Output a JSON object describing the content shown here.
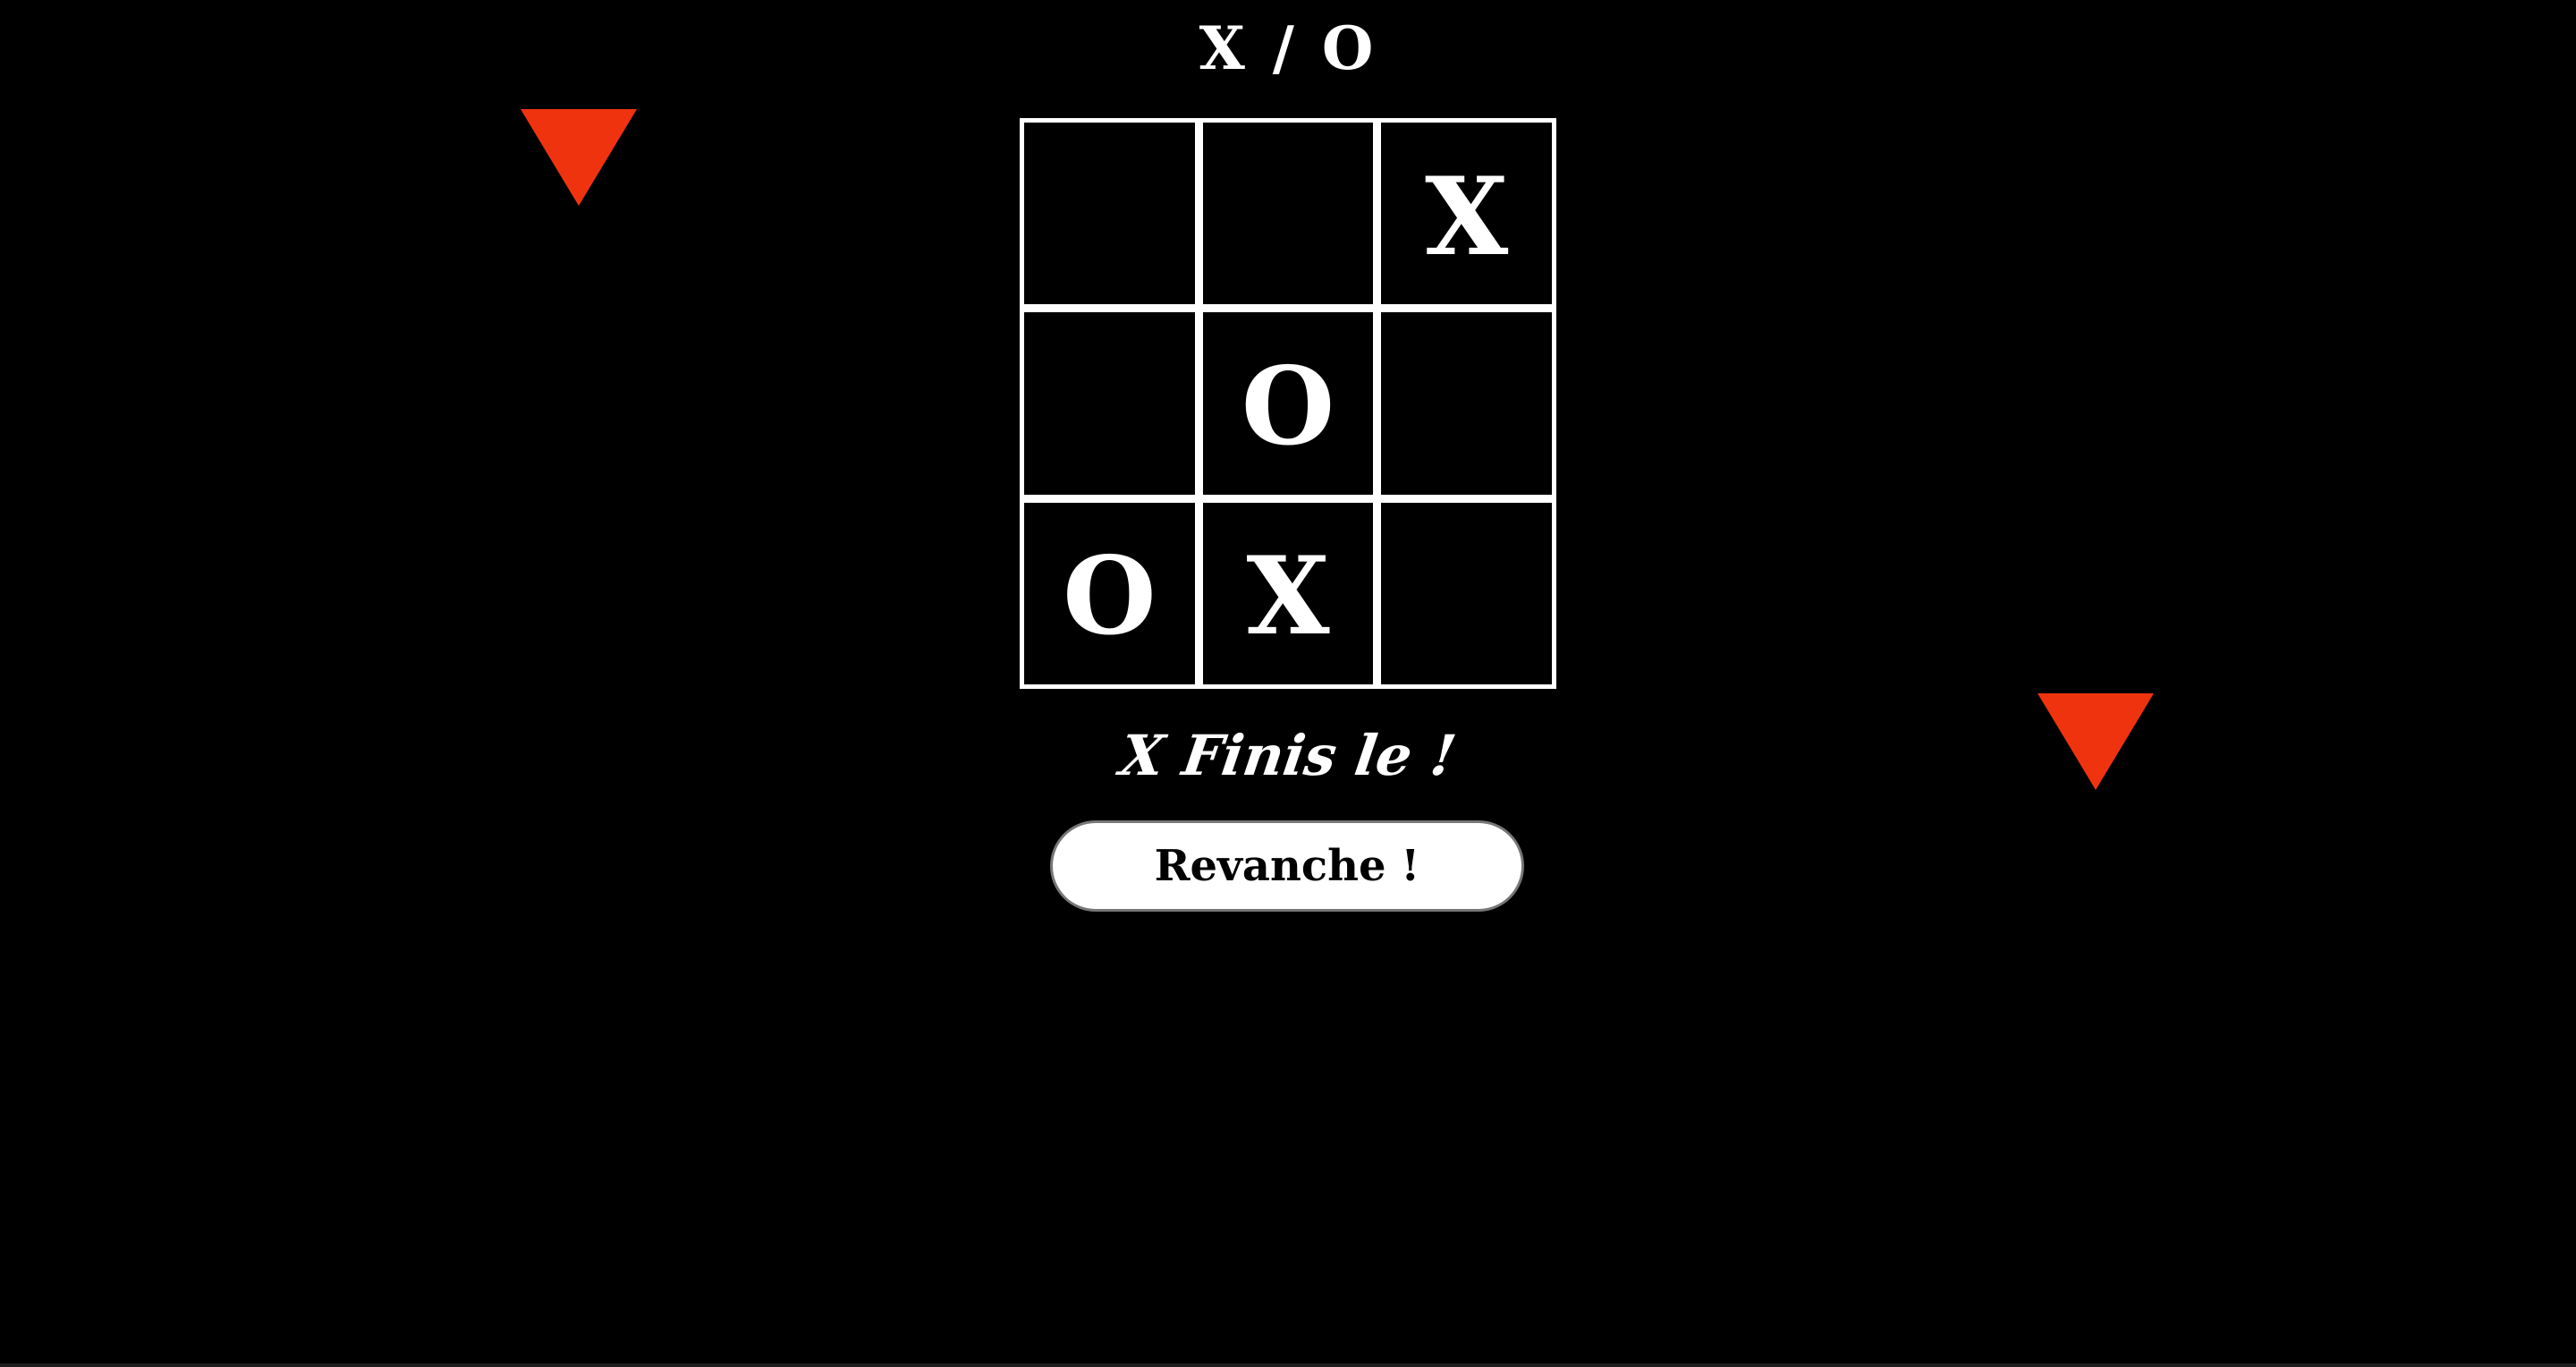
{
  "header": {
    "title": "X / O"
  },
  "decorations": {
    "color": "#f0330f",
    "shape": "downward-triangle"
  },
  "board": {
    "cells": [
      "",
      "",
      "X",
      "",
      "O",
      "",
      "O",
      "X",
      ""
    ]
  },
  "status": {
    "text": "X Finis le !"
  },
  "actions": {
    "rematch_label": "Revanche !"
  }
}
